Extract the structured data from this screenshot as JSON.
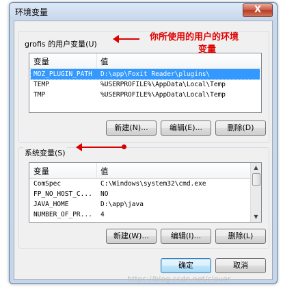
{
  "window": {
    "title": "环境变量",
    "close_label": "X"
  },
  "user_vars": {
    "group_label": "grofis 的用户变量(U)",
    "header": {
      "name": "变量",
      "value": "值"
    },
    "rows": [
      {
        "name": "MOZ_PLUGIN_PATH",
        "value": "D:\\app\\Foxit Reader\\plugins\\"
      },
      {
        "name": "TEMP",
        "value": "%USERPROFILE%\\AppData\\Local\\Temp"
      },
      {
        "name": "TMP",
        "value": "%USERPROFILE%\\AppData\\Local\\Temp"
      }
    ],
    "buttons": {
      "new": "新建(N)...",
      "edit": "编辑(E)...",
      "delete": "删除(D)"
    }
  },
  "system_vars": {
    "group_label": "系统变量(S)",
    "header": {
      "name": "变量",
      "value": "值"
    },
    "rows": [
      {
        "name": "ComSpec",
        "value": "C:\\Windows\\system32\\cmd.exe"
      },
      {
        "name": "FP_NO_HOST_C...",
        "value": "NO"
      },
      {
        "name": "JAVA_HOME",
        "value": "D:\\app\\java"
      },
      {
        "name": "NUMBER_OF_PR...",
        "value": "4"
      }
    ],
    "buttons": {
      "new": "新建(W)...",
      "edit": "编辑(I)...",
      "delete": "删除(L)"
    }
  },
  "dialog_buttons": {
    "ok": "确定",
    "cancel": "取消"
  },
  "annotation": {
    "line1": "你所使用的用户的环境",
    "line2": "变量"
  },
  "watermark": "https://blog.csdn.net/clover",
  "colors": {
    "annotation_red": "#e00000",
    "selection_blue": "#3399ff"
  }
}
